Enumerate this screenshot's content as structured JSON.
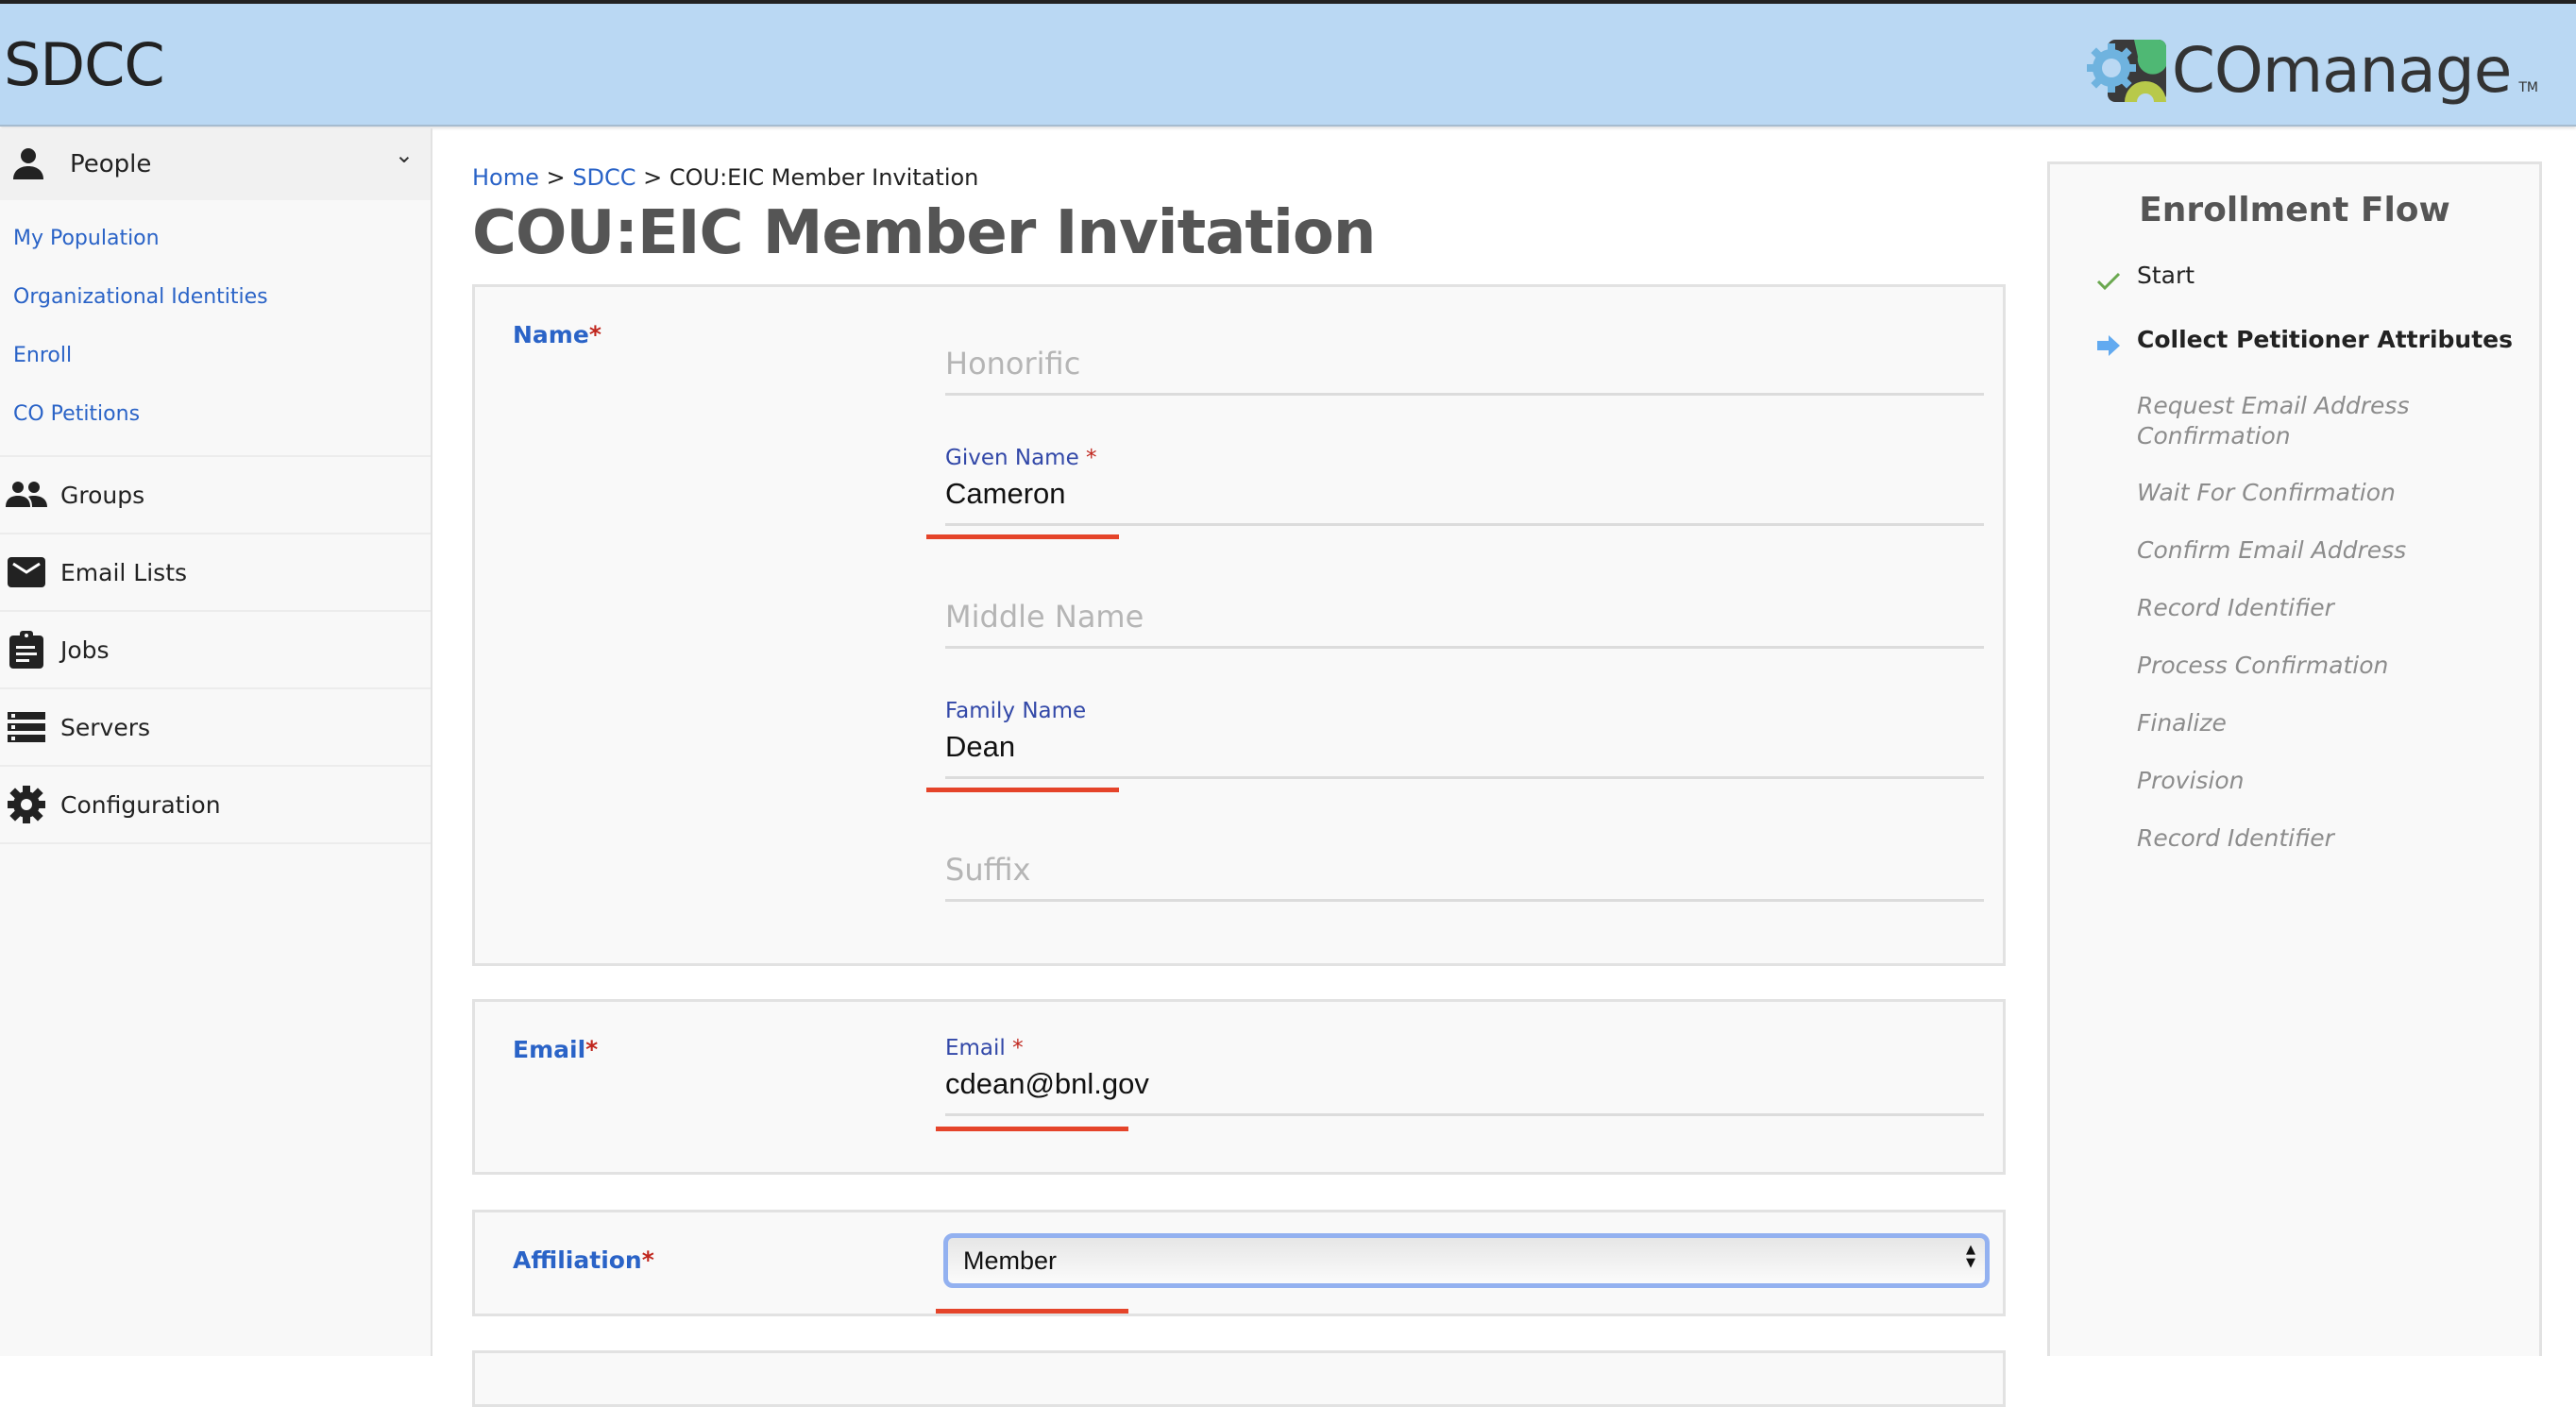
{
  "header": {
    "site_title": "SDCC",
    "logo_text": "COmanage",
    "logo_tm": "TM",
    "logo_colors": {
      "blue": "#6fb3df",
      "green": "#4fb874",
      "dark": "#3a3a3a",
      "yellow": "#b8c94a"
    }
  },
  "sidebar": {
    "people": {
      "label": "People",
      "icon": "person-icon",
      "expanded": true
    },
    "people_links": [
      {
        "label": "My Population"
      },
      {
        "label": "Organizational Identities"
      },
      {
        "label": "Enroll"
      },
      {
        "label": "CO Petitions"
      }
    ],
    "items": [
      {
        "label": "Groups",
        "icon": "groups-icon"
      },
      {
        "label": "Email Lists",
        "icon": "envelope-icon"
      },
      {
        "label": "Jobs",
        "icon": "clipboard-icon"
      },
      {
        "label": "Servers",
        "icon": "server-icon"
      },
      {
        "label": "Configuration",
        "icon": "gear-icon"
      }
    ]
  },
  "breadcrumb": {
    "home": "Home",
    "sep": " > ",
    "co": "SDCC",
    "current": "COU:EIC Member Invitation"
  },
  "page_title": "COU:EIC Member Invitation",
  "form": {
    "required_marker": "*",
    "name": {
      "label": "Name",
      "honorific": {
        "placeholder": "Honorific",
        "value": ""
      },
      "given": {
        "label": "Given Name",
        "value": "Cameron",
        "required": true
      },
      "middle": {
        "placeholder": "Middle Name",
        "value": ""
      },
      "family": {
        "label": "Family Name",
        "value": "Dean"
      },
      "suffix": {
        "placeholder": "Suffix",
        "value": ""
      }
    },
    "email": {
      "label": "Email",
      "field_label": "Email",
      "value": "cdean@bnl.gov",
      "required": true
    },
    "affiliation": {
      "label": "Affiliation",
      "selected": "Member"
    }
  },
  "enrollment_flow": {
    "title": "Enrollment Flow",
    "steps": [
      {
        "label": "Start",
        "status": "done"
      },
      {
        "label": "Collect Petitioner Attributes",
        "status": "current"
      },
      {
        "label": "Request Email Address Confirmation",
        "status": "pending"
      },
      {
        "label": "Wait For Confirmation",
        "status": "pending"
      },
      {
        "label": "Confirm Email Address",
        "status": "pending"
      },
      {
        "label": "Record Identifier",
        "status": "pending"
      },
      {
        "label": "Process Confirmation",
        "status": "pending"
      },
      {
        "label": "Finalize",
        "status": "pending"
      },
      {
        "label": "Provision",
        "status": "pending"
      },
      {
        "label": "Record Identifier",
        "status": "pending"
      }
    ]
  },
  "colors": {
    "header_bg": "#bad8f3",
    "link": "#2a63c7",
    "required": "#c0261d",
    "field_label": "#3248a8",
    "underline_accent": "#e5442a",
    "select_focus": "#93b1f0",
    "check": "#6aa84f",
    "current_arrow": "#62aaf0"
  }
}
